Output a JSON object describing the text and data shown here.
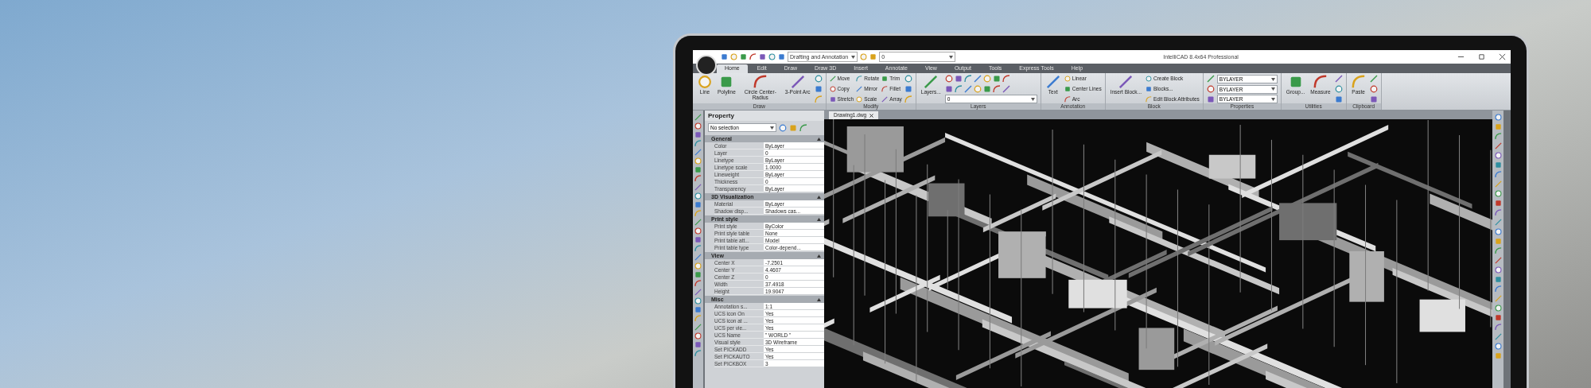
{
  "window": {
    "title": "IntelliCAD 8.4x64 Professional",
    "workspace": "Drafting and Annotation",
    "layer": "0"
  },
  "menu_tabs": [
    {
      "label": "Home",
      "selected": true
    },
    {
      "label": "Edit",
      "selected": false
    },
    {
      "label": "Draw",
      "selected": false
    },
    {
      "label": "Draw 3D",
      "selected": false
    },
    {
      "label": "Insert",
      "selected": false
    },
    {
      "label": "Annotate",
      "selected": false
    },
    {
      "label": "View",
      "selected": false
    },
    {
      "label": "Output",
      "selected": false
    },
    {
      "label": "Tools",
      "selected": false
    },
    {
      "label": "Express Tools",
      "selected": false
    },
    {
      "label": "Help",
      "selected": false
    }
  ],
  "ribbon": [
    {
      "title": "Draw",
      "columns": [
        [
          {
            "kind": "large",
            "label": "Line"
          }
        ],
        [
          {
            "kind": "large",
            "label": "Polyline"
          }
        ],
        [
          {
            "kind": "large",
            "label": "Circle Center-Radius"
          }
        ],
        [
          {
            "kind": "large",
            "label": "3-Point Arc"
          }
        ],
        [
          {
            "kind": "icon"
          },
          {
            "kind": "icon"
          },
          {
            "kind": "icon"
          }
        ]
      ]
    },
    {
      "title": "Modify",
      "columns": [
        [
          {
            "kind": "small",
            "label": "Move"
          },
          {
            "kind": "small",
            "label": "Copy"
          },
          {
            "kind": "small",
            "label": "Stretch"
          }
        ],
        [
          {
            "kind": "small",
            "label": "Rotate"
          },
          {
            "kind": "small",
            "label": "Mirror"
          },
          {
            "kind": "small",
            "label": "Scale"
          }
        ],
        [
          {
            "kind": "small",
            "label": "Trim"
          },
          {
            "kind": "small",
            "label": "Fillet"
          },
          {
            "kind": "small",
            "label": "Array"
          }
        ],
        [
          {
            "kind": "icon"
          },
          {
            "kind": "icon"
          },
          {
            "kind": "icon"
          }
        ]
      ]
    },
    {
      "title": "Layers",
      "columns": [
        [
          {
            "kind": "large",
            "label": "Layers..."
          }
        ],
        [
          {
            "kind": "icons"
          },
          {
            "kind": "icons"
          },
          {
            "kind": "dropdown",
            "value": "0"
          }
        ]
      ]
    },
    {
      "title": "Annotation",
      "columns": [
        [
          {
            "kind": "large",
            "label": "Text"
          }
        ],
        [
          {
            "kind": "small",
            "label": "Linear"
          },
          {
            "kind": "small",
            "label": "Center Lines"
          },
          {
            "kind": "small",
            "label": "Arc"
          }
        ]
      ]
    },
    {
      "title": "Block",
      "columns": [
        [
          {
            "kind": "large",
            "label": "Insert Block..."
          }
        ],
        [
          {
            "kind": "small",
            "label": "Create Block"
          },
          {
            "kind": "small",
            "label": "Blocks..."
          },
          {
            "kind": "small",
            "label": "Edit Block Attributes"
          }
        ]
      ]
    },
    {
      "title": "Properties",
      "columns": [
        [
          {
            "kind": "icon"
          },
          {
            "kind": "icon"
          },
          {
            "kind": "icon"
          }
        ],
        [
          {
            "kind": "dropdown",
            "value": "BYLAYER"
          },
          {
            "kind": "dropdown",
            "value": "BYLAYER"
          },
          {
            "kind": "dropdown",
            "value": "BYLAYER"
          }
        ]
      ]
    },
    {
      "title": "Utilities",
      "columns": [
        [
          {
            "kind": "large",
            "label": "Group..."
          }
        ],
        [
          {
            "kind": "large",
            "label": "Measure"
          }
        ],
        [
          {
            "kind": "icon"
          },
          {
            "kind": "icon"
          },
          {
            "kind": "icon"
          }
        ]
      ]
    },
    {
      "title": "Clipboard",
      "columns": [
        [
          {
            "kind": "large",
            "label": "Paste"
          }
        ],
        [
          {
            "kind": "icon"
          },
          {
            "kind": "icon"
          },
          {
            "kind": "icon"
          }
        ]
      ]
    }
  ],
  "property_panel": {
    "title": "Property",
    "selection": "No selection",
    "sections": [
      {
        "title": "General",
        "expanded": true,
        "rows": [
          {
            "label": "Color",
            "value": "ByLayer"
          },
          {
            "label": "Layer",
            "value": "0"
          },
          {
            "label": "Linetype",
            "value": "ByLayer"
          },
          {
            "label": "Linetype scale",
            "value": "1.0000"
          },
          {
            "label": "Lineweight",
            "value": "ByLayer"
          },
          {
            "label": "Thickness",
            "value": "0"
          },
          {
            "label": "Transparency",
            "value": "ByLayer"
          }
        ]
      },
      {
        "title": "3D Visualization",
        "expanded": true,
        "rows": [
          {
            "label": "Material",
            "value": "ByLayer"
          },
          {
            "label": "Shadow disp...",
            "value": "Shadows cas..."
          }
        ]
      },
      {
        "title": "Print style",
        "expanded": true,
        "rows": [
          {
            "label": "Print style",
            "value": "ByColor"
          },
          {
            "label": "Print style table",
            "value": "None"
          },
          {
            "label": "Print table att...",
            "value": "Model"
          },
          {
            "label": "Print table type",
            "value": "Color-depend..."
          }
        ]
      },
      {
        "title": "View",
        "expanded": true,
        "rows": [
          {
            "label": "Center X",
            "value": "-7.2501"
          },
          {
            "label": "Center Y",
            "value": "4.4607"
          },
          {
            "label": "Center Z",
            "value": "0"
          },
          {
            "label": "Width",
            "value": "37.4918"
          },
          {
            "label": "Height",
            "value": "19.9047"
          }
        ]
      },
      {
        "title": "Misc",
        "expanded": true,
        "rows": [
          {
            "label": "Annotation s...",
            "value": "1:1"
          },
          {
            "label": "UCS icon On",
            "value": "Yes"
          },
          {
            "label": "UCS icon at ...",
            "value": "Yes"
          },
          {
            "label": "UCS per vie...",
            "value": "Yes"
          },
          {
            "label": "UCS Name",
            "value": "\" WORLD \""
          },
          {
            "label": "Visual style",
            "value": "3D Wireframe"
          },
          {
            "label": "Set PICKADD",
            "value": "Yes"
          },
          {
            "label": "Set PICKAUTO",
            "value": "Yes"
          },
          {
            "label": "Set PICKBOX",
            "value": "3"
          }
        ]
      }
    ]
  },
  "document_tabs": [
    {
      "label": "Drawing1.dwg",
      "selected": true
    }
  ]
}
